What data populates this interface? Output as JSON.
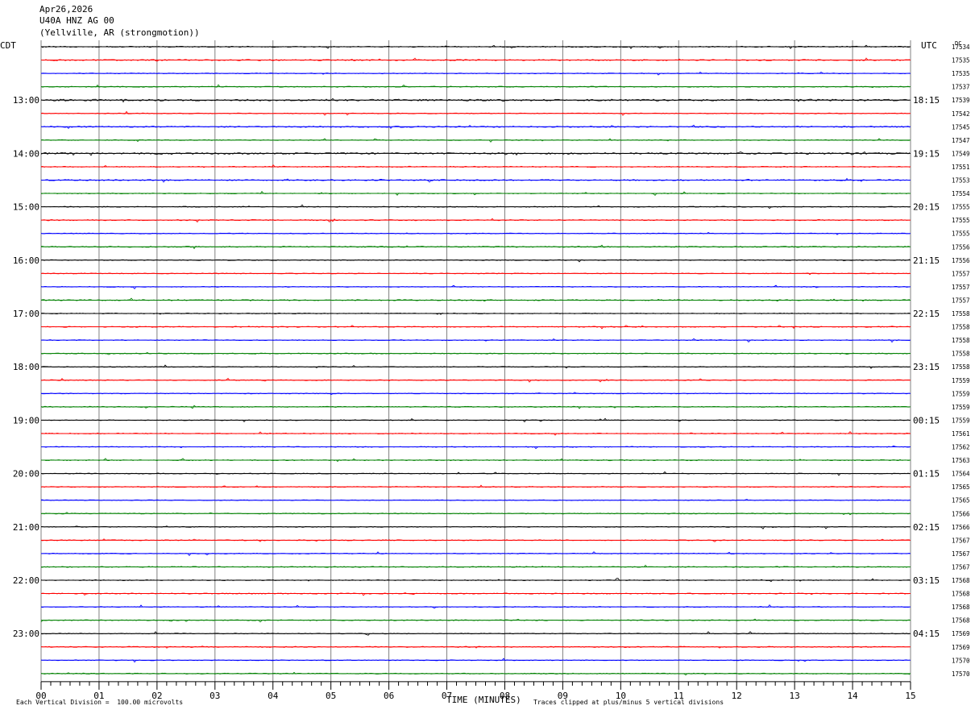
{
  "header": {
    "date": "Apr26,2026",
    "station": "U40A HNZ AG 00",
    "location": "(Yellville, AR (strongmotion))"
  },
  "chart_data": {
    "type": "line",
    "title": "Apr26,2026 U40A HNZ AG 00 (Yellville, AR (strongmotion))",
    "left_axis_label": "CDT",
    "right_axis_label": "UTC",
    "dc_label": "DC",
    "xlabel": "TIME (MINUTES)",
    "xlim": [
      0,
      15
    ],
    "x_ticks": [
      "00",
      "01",
      "02",
      "03",
      "04",
      "05",
      "06",
      "07",
      "08",
      "09",
      "10",
      "11",
      "12",
      "13",
      "14",
      "15"
    ],
    "trace_colors": [
      "#000000",
      "#ff0000",
      "#0000ff",
      "#008000"
    ],
    "left_labels": [
      "",
      "",
      "",
      "",
      "13:00",
      "",
      "",
      "",
      "14:00",
      "",
      "",
      "",
      "15:00",
      "",
      "",
      "",
      "16:00",
      "",
      "",
      "",
      "17:00",
      "",
      "",
      "",
      "18:00",
      "",
      "",
      "",
      "19:00",
      "",
      "",
      "",
      "20:00",
      "",
      "",
      "",
      "21:00",
      "",
      "",
      "",
      "22:00",
      "",
      "",
      "",
      "23:00",
      "",
      "",
      ""
    ],
    "right_labels": [
      "",
      "",
      "",
      "",
      "18:15",
      "",
      "",
      "",
      "19:15",
      "",
      "",
      "",
      "20:15",
      "",
      "",
      "",
      "21:15",
      "",
      "",
      "",
      "22:15",
      "",
      "",
      "",
      "23:15",
      "",
      "",
      "",
      "00:15",
      "",
      "",
      "",
      "01:15",
      "",
      "",
      "",
      "02:15",
      "",
      "",
      "",
      "03:15",
      "",
      "",
      "",
      "04:15",
      "",
      "",
      ""
    ],
    "dc_values": [
      "17534",
      "17535",
      "17535",
      "17537",
      "17539",
      "17542",
      "17545",
      "17547",
      "17549",
      "17551",
      "17553",
      "17554",
      "17555",
      "17555",
      "17555",
      "17556",
      "17556",
      "17557",
      "17557",
      "17557",
      "17558",
      "17558",
      "17558",
      "17558",
      "17558",
      "17559",
      "17559",
      "17559",
      "17559",
      "17561",
      "17562",
      "17563",
      "17564",
      "17565",
      "17565",
      "17566",
      "17566",
      "17567",
      "17567",
      "17567",
      "17568",
      "17568",
      "17568",
      "17568",
      "17569",
      "17569",
      "17570",
      "17570"
    ],
    "trace_activity": [
      1.0,
      1.1,
      0.8,
      0.9,
      1.6,
      0.8,
      1.2,
      0.8,
      1.5,
      0.9,
      1.1,
      0.8,
      0.9,
      1.0,
      0.8,
      1.1,
      0.8,
      0.8,
      0.8,
      1.0,
      0.8,
      0.9,
      0.8,
      0.9,
      0.8,
      0.9,
      0.8,
      0.9,
      0.8,
      0.9,
      0.8,
      0.9,
      0.8,
      0.9,
      0.8,
      0.9,
      0.8,
      0.9,
      0.8,
      0.9,
      0.8,
      0.9,
      0.8,
      0.9,
      0.8,
      1.0,
      0.8,
      0.9
    ],
    "footer_left": "Each Vertical Division =  100.00 microvolts",
    "footer_right": "Traces clipped at plus/minus 5 vertical divisions",
    "grid": true
  }
}
